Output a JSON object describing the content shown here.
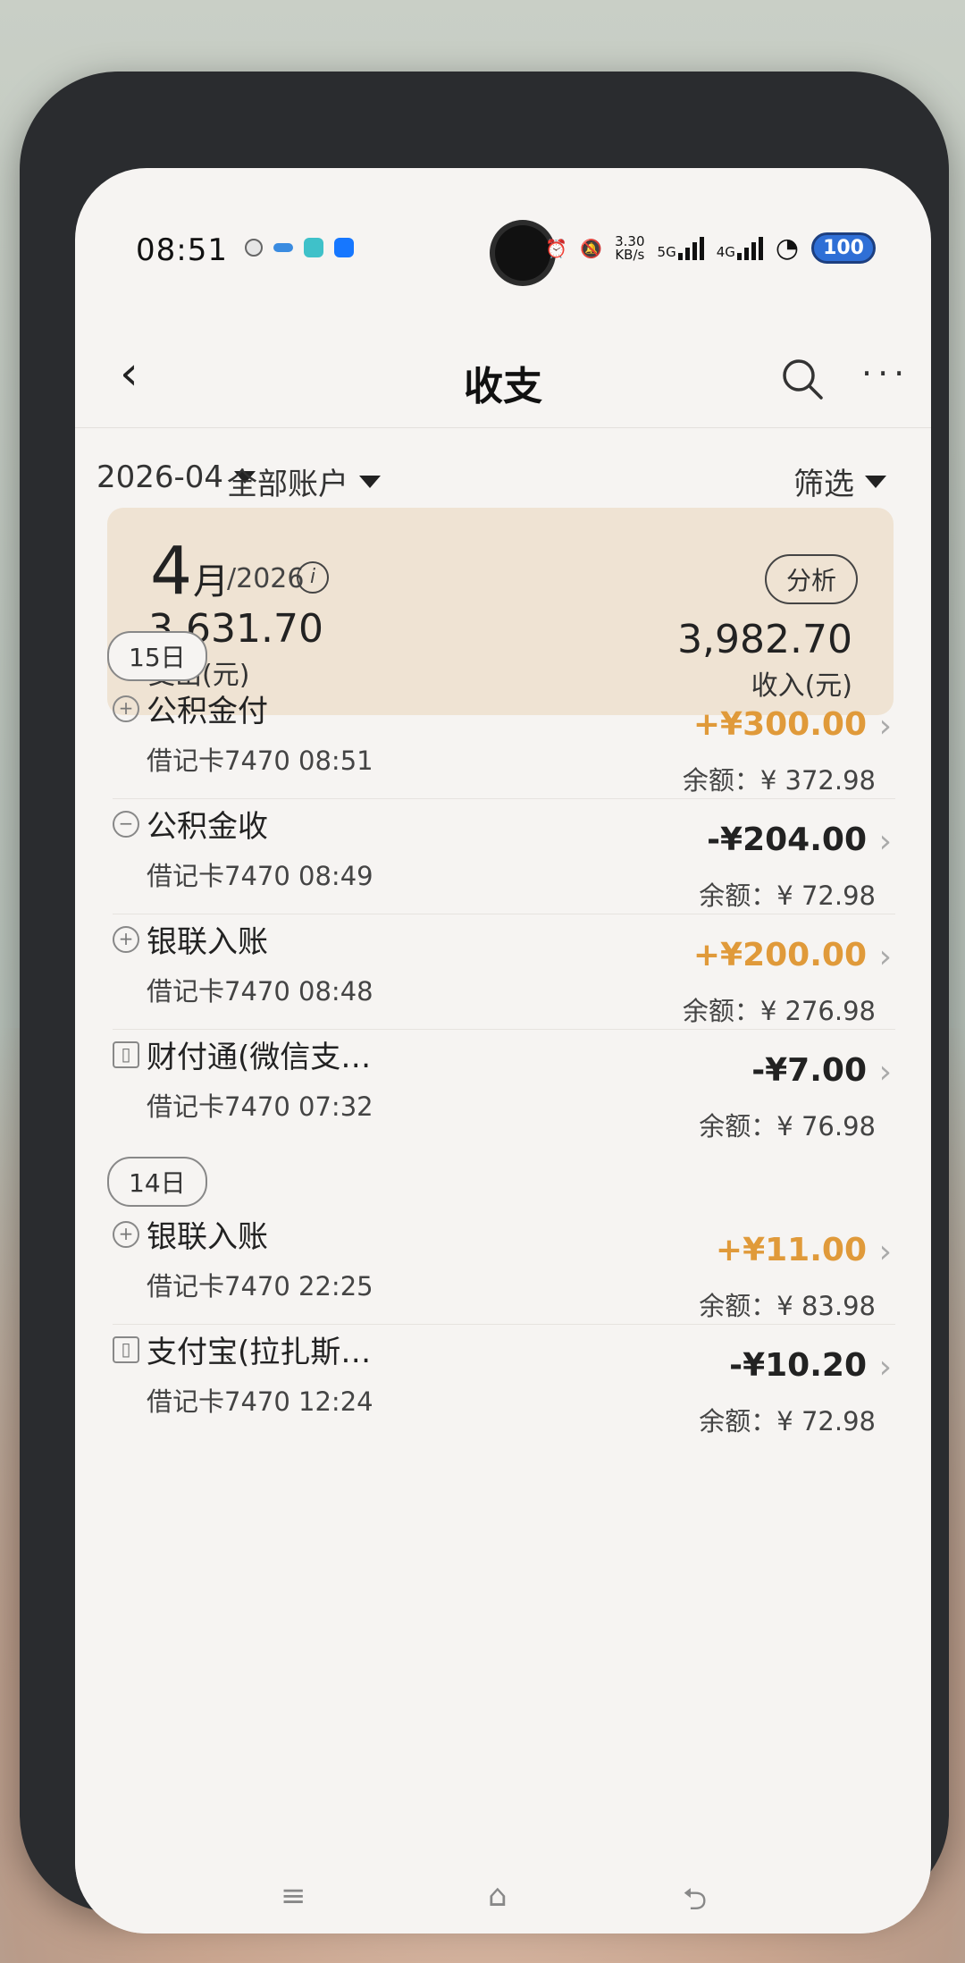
{
  "status_bar": {
    "time": "08:51",
    "speed_top": "3.30",
    "speed_bottom": "KB/s",
    "net1": "5G",
    "net2": "4G",
    "battery": "100"
  },
  "header": {
    "back_icon": "‹",
    "title": "收支",
    "search_icon": "search-icon",
    "more_icon": "···"
  },
  "filters": {
    "month": "2026-04",
    "account": "全部账户",
    "filter": "筛选"
  },
  "summary": {
    "month_num": "4",
    "month_unit": "月",
    "year": "/2026",
    "info": "i",
    "analyze_label": "分析",
    "expense_amount": "3,631.70",
    "expense_label": "支出(元)",
    "income_amount": "3,982.70",
    "income_label": "收入(元)"
  },
  "groups": [
    {
      "date": "15日",
      "transactions": [
        {
          "icon": "plus-circle-icon",
          "name": "公积金付",
          "sub": "借记卡7470 08:51",
          "amount": "+¥300.00",
          "type": "pos",
          "balance": "余额：¥ 372.98"
        },
        {
          "icon": "minus-circle-icon",
          "name": "公积金收",
          "sub": "借记卡7470 08:49",
          "amount": "-¥204.00",
          "type": "neg",
          "balance": "余额：¥ 72.98"
        },
        {
          "icon": "plus-circle-icon",
          "name": "银联入账",
          "sub": "借记卡7470 08:48",
          "amount": "+¥200.00",
          "type": "pos",
          "balance": "余额：¥ 276.98"
        },
        {
          "icon": "shop-icon",
          "name": "财付通(微信支…",
          "sub": "借记卡7470 07:32",
          "amount": "-¥7.00",
          "type": "neg",
          "balance": "余额：¥ 76.98"
        }
      ]
    },
    {
      "date": "14日",
      "transactions": [
        {
          "icon": "plus-circle-icon",
          "name": "银联入账",
          "sub": "借记卡7470 22:25",
          "amount": "+¥11.00",
          "type": "pos",
          "balance": "余额：¥ 83.98"
        },
        {
          "icon": "shop-icon",
          "name": "支付宝(拉扎斯…",
          "sub": "借记卡7470 12:24",
          "amount": "-¥10.20",
          "type": "neg",
          "balance": "余额：¥ 72.98"
        }
      ]
    }
  ],
  "nav_bar": {
    "menu": "≡",
    "home": "⌂",
    "back": "⮌"
  }
}
